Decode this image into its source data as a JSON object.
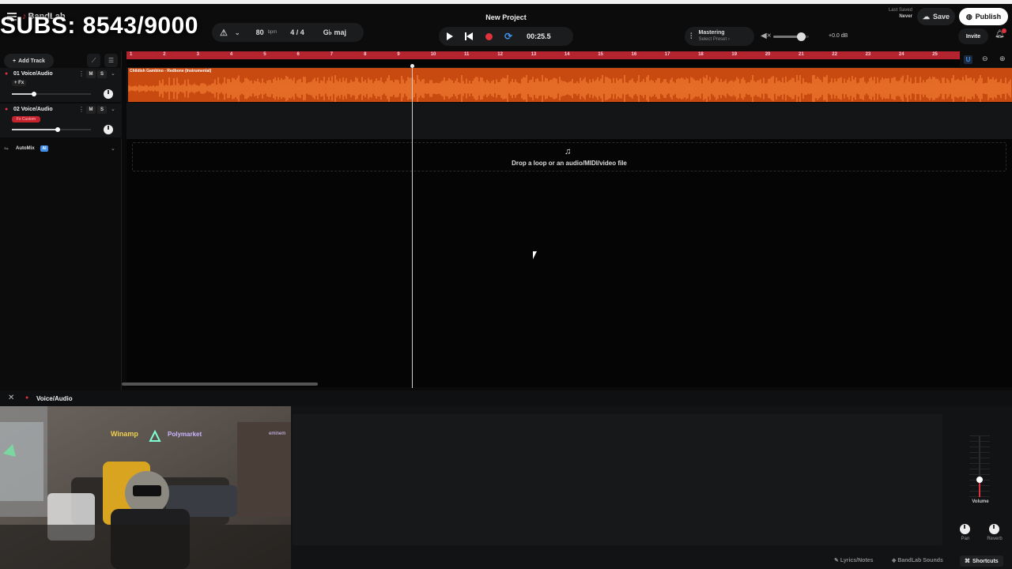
{
  "overlay": {
    "subs_text": "SUBS: 8543/9000"
  },
  "header": {
    "logo": "BandLab",
    "project_title": "New Project",
    "bpm": "80",
    "bpm_unit": "bpm",
    "time_signature": "4 / 4",
    "key": "G♭ maj",
    "time": "00:25.5",
    "mastering_label": "Mastering",
    "mastering_preset": "Select Preset ›",
    "volume_db": "+0.0 dB",
    "volume_level": 0.8,
    "last_saved_label": "Last Saved",
    "last_saved_value": "Never",
    "save_label": "Save",
    "publish_label": "Publish",
    "invite_label": "Invite",
    "notification_count": "1"
  },
  "tracks_panel": {
    "add_track_label": "Add Track",
    "tracks": [
      {
        "name": "01 Voice/Audio",
        "fx": "+ Fx",
        "mute": "M",
        "solo": "S",
        "volume": 0.28
      },
      {
        "name": "02 Voice/Audio",
        "fx": "Fx Custom",
        "mute": "M",
        "solo": "S",
        "volume": 0.58
      }
    ],
    "automix_label": "AutoMix",
    "automix_badge": "AI"
  },
  "timeline": {
    "ruler": [
      "1",
      "2",
      "3",
      "4",
      "5",
      "6",
      "7",
      "8",
      "9",
      "10",
      "11",
      "12",
      "13",
      "14",
      "15",
      "16",
      "17",
      "18",
      "19",
      "20",
      "21",
      "22",
      "23",
      "24",
      "25"
    ],
    "clip_title": "Childish Gambino - Redbone (Instrumental)",
    "drop_text": "Drop a loop or an audio/MIDI/video file",
    "snap_label": "U"
  },
  "editor": {
    "title": "Voice/Audio",
    "volume_label": "Volume",
    "pan_label": "Pan",
    "reverb_label": "Reverb"
  },
  "footer": {
    "lyrics_label": "Lyrics/Notes",
    "sounds_label": "BandLab Sounds",
    "shortcuts_label": "Shortcuts"
  },
  "webcam": {
    "signs": [
      "Winamp",
      "Polymarket",
      "eminem"
    ]
  },
  "colors": {
    "accent_red": "#e0323c",
    "clip_orange": "#c84a10",
    "loop_blue": "#3f8ee8"
  }
}
